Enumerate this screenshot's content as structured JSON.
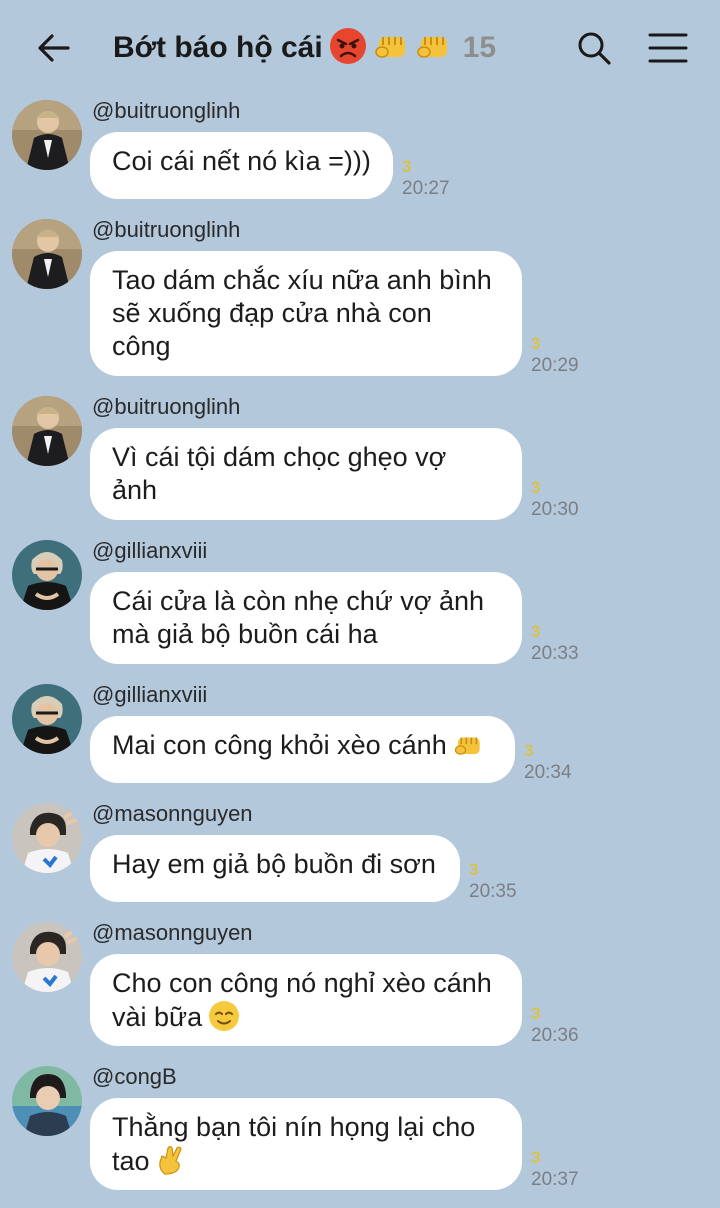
{
  "header": {
    "title": "Bớt báo hộ cái",
    "member_count": "15",
    "icons": [
      "back-arrow-icon",
      "angry-face-icon",
      "fist-icon",
      "fist-icon",
      "search-icon",
      "menu-icon"
    ]
  },
  "colors": {
    "background": "#b4c8dc",
    "bubble": "#ffffff",
    "seen_marker": "#d8c24a"
  },
  "messages": [
    {
      "user": "@buitruonglinh",
      "text": "Coi cái nết nó kìa =)))",
      "seen": "3",
      "time": "20:27"
    },
    {
      "user": "@buitruonglinh",
      "text": "Tao dám chắc xíu nữa anh bình\nsẽ xuống đạp cửa nhà con\ncông",
      "seen": "3",
      "time": "20:29"
    },
    {
      "user": "@buitruonglinh",
      "text": "Vì cái tội dám chọc ghẹo vợ\nảnh",
      "seen": "3",
      "time": "20:30"
    },
    {
      "user": "@gillianxviii",
      "text": "Cái cửa là còn nhẹ chứ vợ ảnh\nmà giả bộ buồn cái ha",
      "seen": "3",
      "time": "20:33"
    },
    {
      "user": "@gillianxviii",
      "text": "Mai con công khỏi xèo cánh",
      "seen": "3",
      "time": "20:34"
    },
    {
      "user": "@masonnguyen",
      "text": "Hay em giả bộ buồn đi sơn",
      "seen": "3",
      "time": "20:35"
    },
    {
      "user": "@masonnguyen",
      "text": "Cho con công nó nghỉ xèo cánh\nvài bữa",
      "seen": "3",
      "time": "20:36"
    },
    {
      "user": "@congB",
      "text": "Thằng bạn tôi nín họng lại cho\ntao",
      "seen": "3",
      "time": "20:37"
    }
  ]
}
